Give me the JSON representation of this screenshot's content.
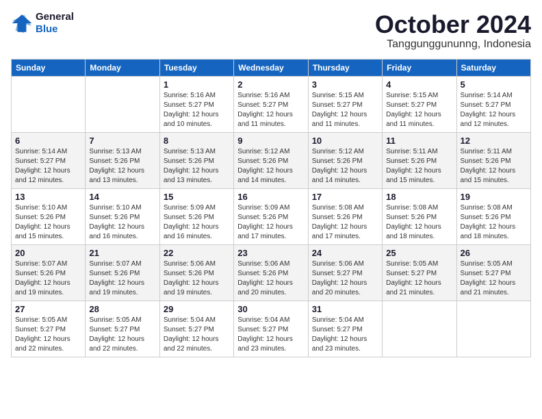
{
  "header": {
    "logo_line1": "General",
    "logo_line2": "Blue",
    "month": "October 2024",
    "location": "Tanggunggununng, Indonesia"
  },
  "weekdays": [
    "Sunday",
    "Monday",
    "Tuesday",
    "Wednesday",
    "Thursday",
    "Friday",
    "Saturday"
  ],
  "weeks": [
    [
      {
        "day": "",
        "info": ""
      },
      {
        "day": "",
        "info": ""
      },
      {
        "day": "1",
        "info": "Sunrise: 5:16 AM\nSunset: 5:27 PM\nDaylight: 12 hours\nand 10 minutes."
      },
      {
        "day": "2",
        "info": "Sunrise: 5:16 AM\nSunset: 5:27 PM\nDaylight: 12 hours\nand 11 minutes."
      },
      {
        "day": "3",
        "info": "Sunrise: 5:15 AM\nSunset: 5:27 PM\nDaylight: 12 hours\nand 11 minutes."
      },
      {
        "day": "4",
        "info": "Sunrise: 5:15 AM\nSunset: 5:27 PM\nDaylight: 12 hours\nand 11 minutes."
      },
      {
        "day": "5",
        "info": "Sunrise: 5:14 AM\nSunset: 5:27 PM\nDaylight: 12 hours\nand 12 minutes."
      }
    ],
    [
      {
        "day": "6",
        "info": "Sunrise: 5:14 AM\nSunset: 5:27 PM\nDaylight: 12 hours\nand 12 minutes."
      },
      {
        "day": "7",
        "info": "Sunrise: 5:13 AM\nSunset: 5:26 PM\nDaylight: 12 hours\nand 13 minutes."
      },
      {
        "day": "8",
        "info": "Sunrise: 5:13 AM\nSunset: 5:26 PM\nDaylight: 12 hours\nand 13 minutes."
      },
      {
        "day": "9",
        "info": "Sunrise: 5:12 AM\nSunset: 5:26 PM\nDaylight: 12 hours\nand 14 minutes."
      },
      {
        "day": "10",
        "info": "Sunrise: 5:12 AM\nSunset: 5:26 PM\nDaylight: 12 hours\nand 14 minutes."
      },
      {
        "day": "11",
        "info": "Sunrise: 5:11 AM\nSunset: 5:26 PM\nDaylight: 12 hours\nand 15 minutes."
      },
      {
        "day": "12",
        "info": "Sunrise: 5:11 AM\nSunset: 5:26 PM\nDaylight: 12 hours\nand 15 minutes."
      }
    ],
    [
      {
        "day": "13",
        "info": "Sunrise: 5:10 AM\nSunset: 5:26 PM\nDaylight: 12 hours\nand 15 minutes."
      },
      {
        "day": "14",
        "info": "Sunrise: 5:10 AM\nSunset: 5:26 PM\nDaylight: 12 hours\nand 16 minutes."
      },
      {
        "day": "15",
        "info": "Sunrise: 5:09 AM\nSunset: 5:26 PM\nDaylight: 12 hours\nand 16 minutes."
      },
      {
        "day": "16",
        "info": "Sunrise: 5:09 AM\nSunset: 5:26 PM\nDaylight: 12 hours\nand 17 minutes."
      },
      {
        "day": "17",
        "info": "Sunrise: 5:08 AM\nSunset: 5:26 PM\nDaylight: 12 hours\nand 17 minutes."
      },
      {
        "day": "18",
        "info": "Sunrise: 5:08 AM\nSunset: 5:26 PM\nDaylight: 12 hours\nand 18 minutes."
      },
      {
        "day": "19",
        "info": "Sunrise: 5:08 AM\nSunset: 5:26 PM\nDaylight: 12 hours\nand 18 minutes."
      }
    ],
    [
      {
        "day": "20",
        "info": "Sunrise: 5:07 AM\nSunset: 5:26 PM\nDaylight: 12 hours\nand 19 minutes."
      },
      {
        "day": "21",
        "info": "Sunrise: 5:07 AM\nSunset: 5:26 PM\nDaylight: 12 hours\nand 19 minutes."
      },
      {
        "day": "22",
        "info": "Sunrise: 5:06 AM\nSunset: 5:26 PM\nDaylight: 12 hours\nand 19 minutes."
      },
      {
        "day": "23",
        "info": "Sunrise: 5:06 AM\nSunset: 5:26 PM\nDaylight: 12 hours\nand 20 minutes."
      },
      {
        "day": "24",
        "info": "Sunrise: 5:06 AM\nSunset: 5:27 PM\nDaylight: 12 hours\nand 20 minutes."
      },
      {
        "day": "25",
        "info": "Sunrise: 5:05 AM\nSunset: 5:27 PM\nDaylight: 12 hours\nand 21 minutes."
      },
      {
        "day": "26",
        "info": "Sunrise: 5:05 AM\nSunset: 5:27 PM\nDaylight: 12 hours\nand 21 minutes."
      }
    ],
    [
      {
        "day": "27",
        "info": "Sunrise: 5:05 AM\nSunset: 5:27 PM\nDaylight: 12 hours\nand 22 minutes."
      },
      {
        "day": "28",
        "info": "Sunrise: 5:05 AM\nSunset: 5:27 PM\nDaylight: 12 hours\nand 22 minutes."
      },
      {
        "day": "29",
        "info": "Sunrise: 5:04 AM\nSunset: 5:27 PM\nDaylight: 12 hours\nand 22 minutes."
      },
      {
        "day": "30",
        "info": "Sunrise: 5:04 AM\nSunset: 5:27 PM\nDaylight: 12 hours\nand 23 minutes."
      },
      {
        "day": "31",
        "info": "Sunrise: 5:04 AM\nSunset: 5:27 PM\nDaylight: 12 hours\nand 23 minutes."
      },
      {
        "day": "",
        "info": ""
      },
      {
        "day": "",
        "info": ""
      }
    ]
  ]
}
